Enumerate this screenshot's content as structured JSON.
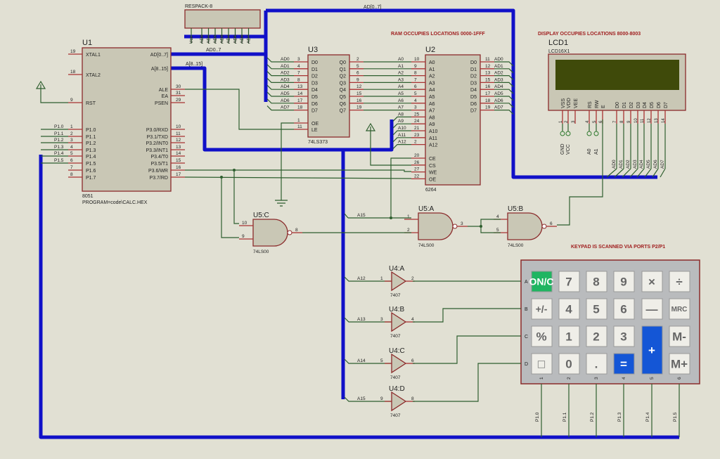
{
  "notes": {
    "ram": "RAM OCCUPIES  LOCATIONS 0000-1FFF",
    "display": "DISPLAY OCCUPIES  LOCATIONS 8000-8003",
    "keypad": "KEYPAD IS SCANNED VIA PORTS P2/P1"
  },
  "bus_labels": {
    "ad": "AD[0..7]",
    "a": "A[8..15]",
    "respack_ad": "AD0..7"
  },
  "u1": {
    "ref": "U1",
    "part": "8051",
    "program": "PROGRAM=code\\CALC.HEX",
    "left_pins": [
      [
        "19",
        "XTAL1"
      ],
      [
        "18",
        "XTAL2"
      ],
      [
        "9",
        "RST"
      ],
      [
        "1",
        "P1.0"
      ],
      [
        "2",
        "P1.1"
      ],
      [
        "3",
        "P1.2"
      ],
      [
        "4",
        "P1.3"
      ],
      [
        "5",
        "P1.4"
      ],
      [
        "6",
        "P1.5"
      ],
      [
        "7",
        "P1.6"
      ],
      [
        "8",
        "P1.7"
      ]
    ],
    "right_pins": [
      [
        "",
        "AD[0..7]"
      ],
      [
        "",
        "A[8..15]"
      ],
      [
        "30",
        "ALE"
      ],
      [
        "31",
        "EA"
      ],
      [
        "29",
        "PSEN"
      ],
      [
        "10",
        "P3.0/RXD"
      ],
      [
        "11",
        "P3.1/TXD"
      ],
      [
        "12",
        "P3.2/INT0"
      ],
      [
        "13",
        "P3.3/INT1"
      ],
      [
        "14",
        "P3.4/T0"
      ],
      [
        "15",
        "P3.5/T1"
      ],
      [
        "16",
        "P3.6/WR"
      ],
      [
        "17",
        "P3.7/RD"
      ]
    ],
    "net_labels": [
      "P1.0",
      "P1.1",
      "P1.2",
      "P1.3",
      "P1.4",
      "P1.5"
    ]
  },
  "u3": {
    "ref": "U3",
    "part": "74LS373",
    "left_pins": [
      [
        "3",
        "D0",
        "AD0"
      ],
      [
        "4",
        "D1",
        "AD1"
      ],
      [
        "7",
        "D2",
        "AD2"
      ],
      [
        "8",
        "D3",
        "AD3"
      ],
      [
        "13",
        "D4",
        "AD4"
      ],
      [
        "14",
        "D5",
        "AD5"
      ],
      [
        "17",
        "D6",
        "AD6"
      ],
      [
        "18",
        "D7",
        "AD7"
      ],
      [
        "1",
        "OE",
        ""
      ],
      [
        "11",
        "LE",
        ""
      ]
    ],
    "right_pins": [
      [
        "2",
        "Q0"
      ],
      [
        "5",
        "Q1"
      ],
      [
        "6",
        "Q2"
      ],
      [
        "9",
        "Q3"
      ],
      [
        "12",
        "Q4"
      ],
      [
        "15",
        "Q5"
      ],
      [
        "16",
        "Q6"
      ],
      [
        "19",
        "Q7"
      ]
    ]
  },
  "u2": {
    "ref": "U2",
    "part": "6264",
    "left_pins": [
      [
        "10",
        "A0"
      ],
      [
        "9",
        "A1"
      ],
      [
        "8",
        "A2"
      ],
      [
        "7",
        "A3"
      ],
      [
        "6",
        "A4"
      ],
      [
        "5",
        "A5"
      ],
      [
        "4",
        "A6"
      ],
      [
        "3",
        "A7"
      ],
      [
        "25",
        "A8"
      ],
      [
        "24",
        "A9"
      ],
      [
        "21",
        "A10"
      ],
      [
        "23",
        "A11"
      ],
      [
        "2",
        "A12"
      ],
      [
        "20",
        "CE"
      ],
      [
        "26",
        "CS"
      ],
      [
        "27",
        "WE"
      ],
      [
        "22",
        "OE"
      ]
    ],
    "right_pins": [
      [
        "11",
        "D0",
        "AD0"
      ],
      [
        "12",
        "D1",
        "AD1"
      ],
      [
        "13",
        "D2",
        "AD2"
      ],
      [
        "15",
        "D3",
        "AD3"
      ],
      [
        "16",
        "D4",
        "AD4"
      ],
      [
        "17",
        "D5",
        "AD5"
      ],
      [
        "18",
        "D6",
        "AD6"
      ],
      [
        "19",
        "D7",
        "AD7"
      ]
    ]
  },
  "lcd": {
    "ref": "LCD1",
    "part": "LCD16X1",
    "pins": [
      [
        "1",
        "VSS"
      ],
      [
        "2",
        "VDD"
      ],
      [
        "3",
        "VEE"
      ],
      [
        "4",
        "RS"
      ],
      [
        "5",
        "RW"
      ],
      [
        "6",
        "E"
      ],
      [
        "7",
        "D0"
      ],
      [
        "8",
        "D1"
      ],
      [
        "9",
        "D2"
      ],
      [
        "10",
        "D3"
      ],
      [
        "11",
        "D4"
      ],
      [
        "12",
        "D5"
      ],
      [
        "13",
        "D6"
      ],
      [
        "14",
        "D7"
      ]
    ],
    "terminals": [
      "GND",
      "VCC",
      "A0",
      "A1"
    ],
    "bus_taps": [
      "AD0",
      "AD1",
      "AD2",
      "AD3",
      "AD4",
      "AD5",
      "AD6",
      "AD7"
    ],
    "screen_color": "#3f4a0a"
  },
  "respack": {
    "part": "RESPACK-8",
    "pins": [
      "Vcc",
      "AD0",
      "AD1",
      "AD2",
      "AD3",
      "AD4",
      "AD5",
      "AD6",
      "AD7"
    ]
  },
  "gates": [
    {
      "ref": "U5:C",
      "part": "74LS00",
      "in": [
        "10",
        "9"
      ],
      "out": "8"
    },
    {
      "ref": "U5:A",
      "part": "74LS00",
      "in": [
        "1",
        "2"
      ],
      "out": "3",
      "net": "A15"
    },
    {
      "ref": "U5:B",
      "part": "74LS00",
      "in": [
        "4",
        "5"
      ],
      "out": "6"
    }
  ],
  "buffers": [
    {
      "ref": "U4:A",
      "part": "7407",
      "in": "1",
      "out": "2",
      "net": "A12"
    },
    {
      "ref": "U4:B",
      "part": "7407",
      "in": "3",
      "out": "4",
      "net": "A13"
    },
    {
      "ref": "U4:C",
      "part": "7407",
      "in": "5",
      "out": "6",
      "net": "A14"
    },
    {
      "ref": "U4:D",
      "part": "7407",
      "in": "9",
      "out": "8",
      "net": "A15"
    }
  ],
  "keypad": {
    "rows": [
      "A",
      "B",
      "C",
      "D"
    ],
    "cols": [
      "1",
      "2",
      "3",
      "4",
      "5",
      "6"
    ],
    "col_nets": [
      "P1.0",
      "P1.1",
      "P1.2",
      "P1.3",
      "P1.4",
      "P1.5"
    ],
    "keys": [
      [
        "ON/C",
        "7",
        "8",
        "9",
        "×",
        "÷"
      ],
      [
        "+/-",
        "4",
        "5",
        "6",
        "—",
        "MRC"
      ],
      [
        "%",
        "1",
        "2",
        "3",
        "+",
        "M-"
      ],
      [
        "□",
        "0",
        ".",
        "=",
        "",
        "M+"
      ]
    ],
    "colors": {
      "on": "#1fb561",
      "blue": "#1456d6",
      "key": "#efeee8",
      "body": "#b9bbbd"
    }
  },
  "colors": {
    "wire": "#2e5e2e",
    "bus": "#1010c8",
    "pin": "#a83232",
    "chip": "#c9c7b5"
  }
}
